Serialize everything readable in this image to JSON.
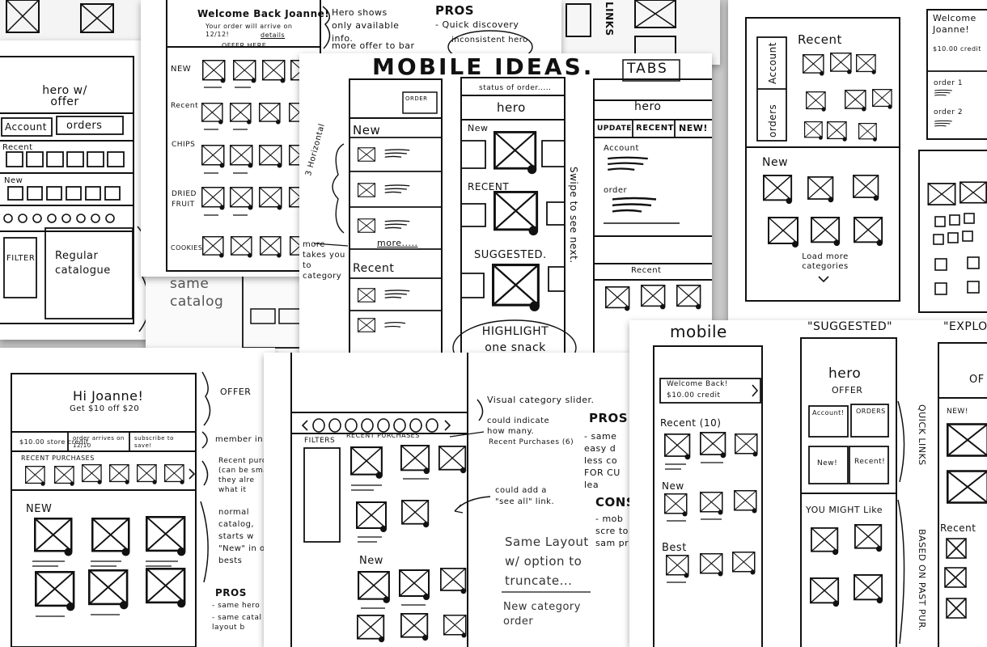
{
  "sheet_tl": {
    "banner": "hero w/ offer",
    "tab_account": "Account",
    "tab_orders": "orders",
    "recent": "Recent",
    "new": "New",
    "filter": "FILTER",
    "regular_catalog": "Regular catalogue",
    "same_catalog": "same catalog"
  },
  "sheet_tc": {
    "welcome": "Welcome Back Joanne!",
    "order_line": "Your order will arrive on 12/12!",
    "details": "details",
    "offer_here": "OFFER HERE",
    "rows": [
      "NEW",
      "Recent",
      "CHIPS",
      "DRIED FRUIT",
      "COOKIES"
    ]
  },
  "sheet_tc_notes": {
    "hero_note": "Hero shows only available info.",
    "more_offer": "more offer to bar",
    "pros": "PROS",
    "quick_discovery": "- Quick discovery",
    "inconsistent": "inconsistent hero"
  },
  "sheet_tabs_partial": {
    "links": "LINKS"
  },
  "sheet_mobile": {
    "title": "MOBILE IDEAS.",
    "tabs_label": "TABS",
    "order_box": "ORDER",
    "new": "New",
    "more": "more.....",
    "recent": "Recent",
    "note_horizontal": "3 Horizontal",
    "note_more": "more takes you to category",
    "status_of_order": "status of order.....",
    "hero": "hero",
    "new2": "New",
    "recent2": "RECENT",
    "suggested": "SUGGESTED.",
    "highlight": "HIGHLIGHT one snack",
    "swipe": "Swipe to see next.",
    "tab_update": "UPDATE",
    "tab_recent": "RECENT",
    "tab_new": "NEW!",
    "account": "Account",
    "order": "order",
    "recent3": "Recent"
  },
  "sheet_tr": {
    "recent": "Recent",
    "account": "Account",
    "orders": "orders",
    "new": "New",
    "load_more": "Load more categories",
    "welcome": "Welcome Joanne!",
    "credit": "$10.00 credit",
    "order1": "order 1",
    "order2": "order 2"
  },
  "sheet_bl": {
    "hi": "Hi Joanne!",
    "offer": "Get $10 off $20",
    "credit": "$10.00 store credit",
    "order_arrives": "order arrives on 12/10",
    "subscribe": "subscribe to save!",
    "recent_purchases": "RECENT PURCHASES",
    "new": "NEW",
    "note_offer": "OFFER",
    "note_member": "member in",
    "note_recent": "Recent purc (can be sma they alre what it",
    "note_normal": "normal catalog, starts w \"New\" in of bests",
    "pros": "PROS",
    "pros_1": "- same hero",
    "pros_2": "- same catal layout b"
  },
  "sheet_bc": {
    "filters": "FILTERS",
    "recent_purchases": "RECENT PURCHASES",
    "new": "New",
    "note_slider": "Visual category slider.",
    "note_indicate": "could indicate how many.",
    "note_recent_count": "Recent Purchases (6)",
    "note_see_all": "could add a \"see all\" link.",
    "same_layout": "Same Layout w/ option to truncate...",
    "new_category": "New category order",
    "pros": "PROS",
    "pros_text": "- same easy d less co FOR CU lea",
    "cons": "CONS",
    "cons_text": "- mob scre to sam pr"
  },
  "sheet_br": {
    "mobile": "mobile",
    "suggested": "\"SUGGESTED\"",
    "explore": "\"EXPLO",
    "welcome": "Welcome Back!",
    "credit": "$10.00 credit",
    "recent10": "Recent (10)",
    "new": "New",
    "best": "Best",
    "hero": "hero",
    "offer": "OFFER",
    "account": "Account!",
    "orders": "ORDERS",
    "new_badge": "New!",
    "recent_badge": "Recent!",
    "you_might_like": "YOU MIGHT Like",
    "quick_links": "QUICK LINKS",
    "based_on": "BASED ON PAST PUR.",
    "offer_partial": "OF",
    "new_partial": "NEW!",
    "recent_partial": "Recent"
  }
}
